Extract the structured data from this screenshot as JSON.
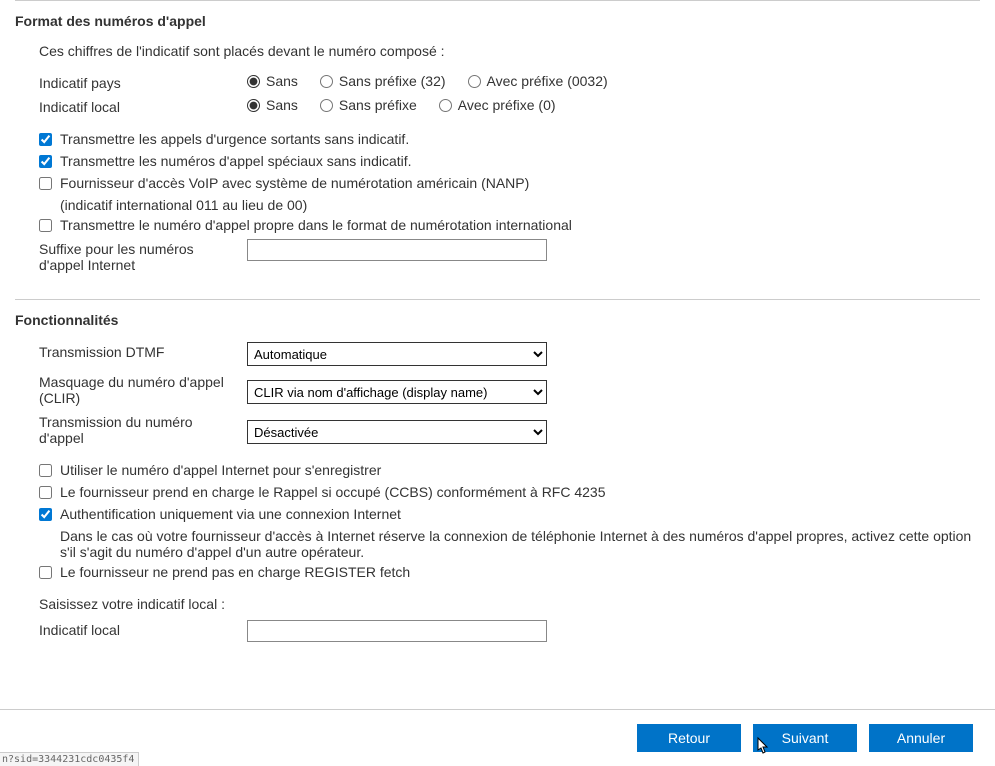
{
  "sections": {
    "format": {
      "title": "Format des numéros d'appel",
      "intro": "Ces chiffres de l'indicatif sont placés devant le numéro composé :",
      "country_label": "Indicatif pays",
      "local_label": "Indicatif local",
      "country_options": {
        "opt1": "Sans",
        "opt2": "Sans préfixe (32)",
        "opt3": "Avec préfixe (0032)"
      },
      "local_options": {
        "opt1": "Sans",
        "opt2": "Sans préfixe",
        "opt3": "Avec préfixe (0)"
      },
      "cb_emergency": "Transmettre les appels d'urgence sortants sans indicatif.",
      "cb_special": "Transmettre les numéros d'appel spéciaux sans indicatif.",
      "cb_nanp": "Fournisseur d'accès VoIP avec système de numérotation américain (NANP)",
      "cb_nanp_sub": "(indicatif international 011 au lieu de 00)",
      "cb_intl_own": "Transmettre le numéro d'appel propre dans le format de numérotation international",
      "suffix_label_l1": "Suffixe pour les numéros",
      "suffix_label_l2": "d'appel Internet",
      "suffix_value": ""
    },
    "features": {
      "title": "Fonctionnalités",
      "dtmf_label": "Transmission DTMF",
      "dtmf_value": "Automatique",
      "clir_label_l1": "Masquage du numéro d'appel",
      "clir_label_l2": "(CLIR)",
      "clir_value": "CLIR via nom d'affichage (display name)",
      "transnum_label_l1": "Transmission du numéro",
      "transnum_label_l2": "d'appel",
      "transnum_value": "Désactivée",
      "cb_use_internet_num": "Utiliser le numéro d'appel Internet pour s'enregistrer",
      "cb_ccbs": "Le fournisseur prend en charge le Rappel si occupé (CCBS) conformément à RFC 4235",
      "cb_auth": "Authentification uniquement via une connexion Internet",
      "cb_auth_desc": "Dans le cas où votre fournisseur d'accès à Internet réserve la connexion de téléphonie Internet à des numéros d'appel propres, activez cette option s'il s'agit du numéro d'appel d'un autre opérateur.",
      "cb_no_register_fetch": "Le fournisseur ne prend pas en charge REGISTER fetch",
      "local_prompt": "Saisissez votre indicatif local :",
      "local_field_label": "Indicatif local",
      "local_value": ""
    }
  },
  "buttons": {
    "back": "Retour",
    "next": "Suivant",
    "cancel": "Annuler"
  },
  "status_url": "n?sid=3344231cdc0435f4"
}
